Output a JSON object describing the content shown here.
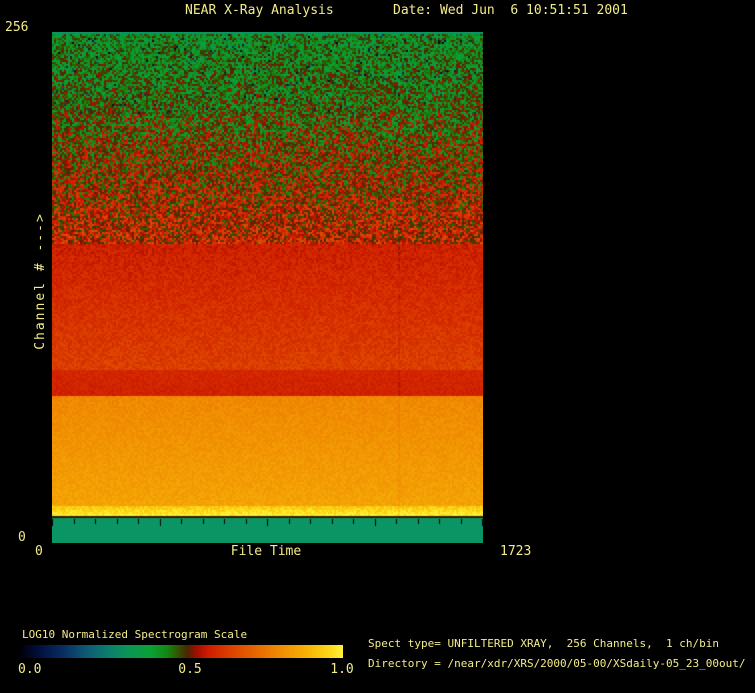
{
  "header": {
    "title": "NEAR X-Ray Analysis",
    "date": "Date: Wed Jun  6 10:51:51 2001"
  },
  "chart_data": {
    "type": "heatmap",
    "title": "NEAR X-Ray Analysis",
    "xlabel": "File Time",
    "ylabel": "Channel # --->",
    "xlim": [
      0,
      1723
    ],
    "ylim": [
      0,
      256
    ],
    "x_tick_labels": {
      "min": "0",
      "max": "1723"
    },
    "y_tick_labels": {
      "min": "0",
      "max": "256"
    },
    "grid": false,
    "colorbar": {
      "title": "LOG10 Normalized Spectrogram Scale",
      "ticks": [
        "0.0",
        "0.5",
        "1.0"
      ],
      "range": [
        0.0,
        1.0
      ],
      "stops": [
        {
          "p": 0.0,
          "c": "#00000E"
        },
        {
          "p": 0.06,
          "c": "#021244"
        },
        {
          "p": 0.13,
          "c": "#0A2E62"
        },
        {
          "p": 0.2,
          "c": "#0D5A74"
        },
        {
          "p": 0.27,
          "c": "#0C7E6E"
        },
        {
          "p": 0.33,
          "c": "#0B9556"
        },
        {
          "p": 0.4,
          "c": "#0AA136"
        },
        {
          "p": 0.45,
          "c": "#118A14"
        },
        {
          "p": 0.48,
          "c": "#2E5E00"
        },
        {
          "p": 0.515,
          "c": "#4A2600"
        },
        {
          "p": 0.545,
          "c": "#A30E00"
        },
        {
          "p": 0.58,
          "c": "#CE1C00"
        },
        {
          "p": 0.65,
          "c": "#DC4100"
        },
        {
          "p": 0.72,
          "c": "#E66300"
        },
        {
          "p": 0.8,
          "c": "#F08A02"
        },
        {
          "p": 0.88,
          "c": "#F6AE06"
        },
        {
          "p": 0.95,
          "c": "#FCD413"
        },
        {
          "p": 1.0,
          "c": "#FFF23C"
        }
      ]
    },
    "bands": [
      {
        "ch": [
          0,
          12.3
        ],
        "solid": "#0B9464"
      },
      {
        "ch": [
          12.3,
          13.2
        ],
        "solid": "#2E1C00"
      },
      {
        "ch": [
          13.2,
          19
        ],
        "v": [
          1.0,
          0.92
        ],
        "noise": 0.035
      },
      {
        "ch": [
          19,
          74
        ],
        "v": [
          0.855,
          0.795
        ],
        "noise": 0.022
      },
      {
        "ch": [
          74,
          87
        ],
        "v": [
          0.59,
          0.6
        ],
        "noise": 0.018
      },
      {
        "ch": [
          87,
          150
        ],
        "v": [
          0.645,
          0.585
        ],
        "noise": 0.03
      },
      {
        "ch": [
          150,
          215
        ],
        "v": [
          0.585,
          0.48
        ],
        "noise": 0.105
      },
      {
        "ch": [
          215,
          254.8
        ],
        "v": [
          0.48,
          0.43
        ],
        "noise": 0.09,
        "p_lo": 0.03,
        "d_lo": 0.35
      },
      {
        "ch": [
          254.8,
          256
        ],
        "solid": "#0B9464"
      }
    ],
    "artifact_column_frac": 0.802,
    "x_minor_tick_count": 20
  },
  "footer": {
    "spect_info": "Spect type= UNFILTERED XRAY,  256 Channels,  1 ch/bin",
    "directory": "Directory = /near/xdr/XRS/2000/05-00/XSdaily-05_23_00out/"
  },
  "colors": {
    "background": "#000000",
    "text": "#F3ED8A",
    "nodata_strip": "#0B9464"
  }
}
